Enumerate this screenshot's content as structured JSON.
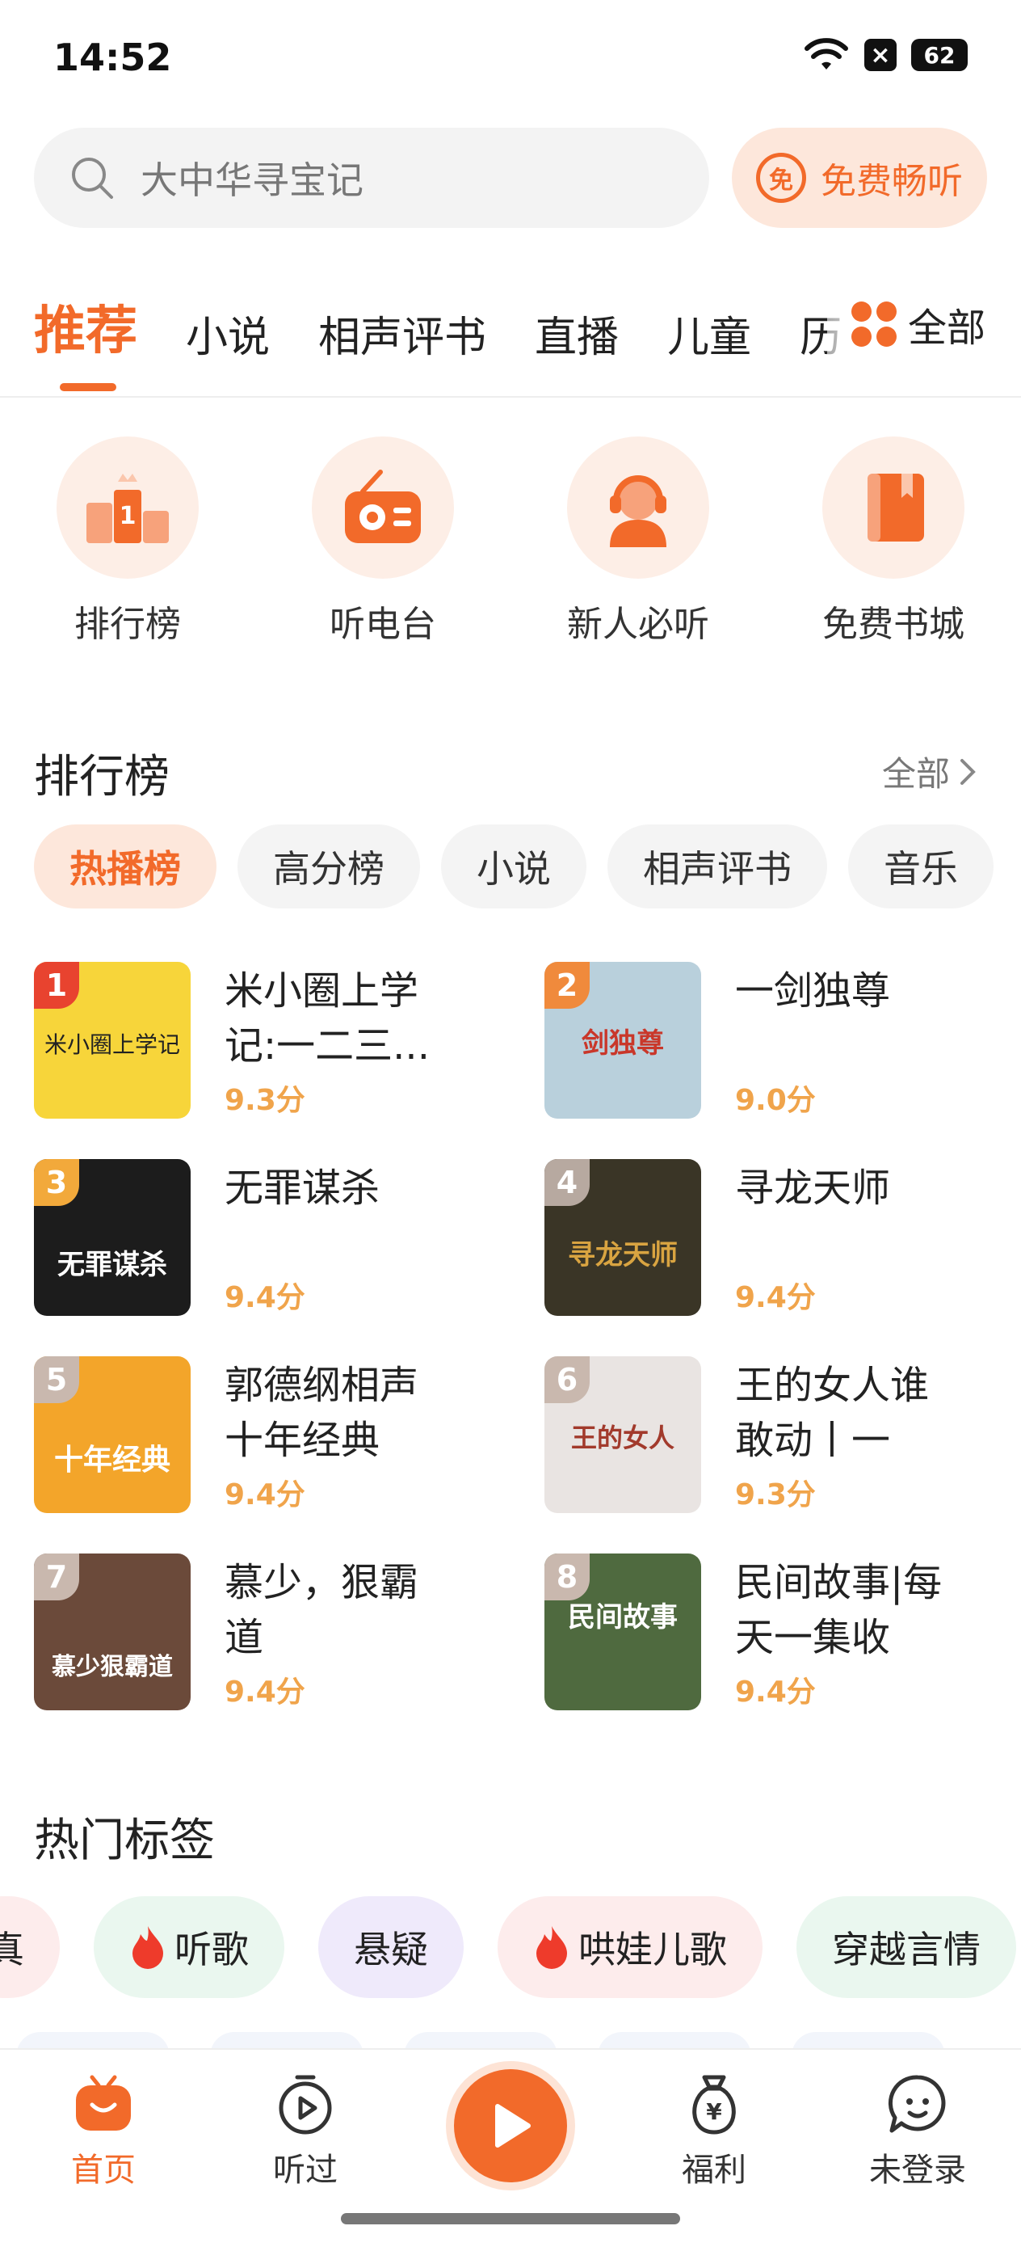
{
  "status_bar": {
    "time": "14:52",
    "battery": "62"
  },
  "search": {
    "placeholder": "大中华寻宝记",
    "free_label": "免费畅听",
    "free_icon_char": "免"
  },
  "tabs": [
    {
      "label": "推荐",
      "active": true
    },
    {
      "label": "小说"
    },
    {
      "label": "相声评书"
    },
    {
      "label": "直播"
    },
    {
      "label": "儿童"
    },
    {
      "label": "历"
    }
  ],
  "tabs_all_label": "全部",
  "quick_entries": [
    {
      "label": "排行榜",
      "icon": "podium-icon"
    },
    {
      "label": "听电台",
      "icon": "radio-icon"
    },
    {
      "label": "新人必听",
      "icon": "headset-person-icon"
    },
    {
      "label": "免费书城",
      "icon": "book-icon"
    }
  ],
  "ranking": {
    "title": "排行榜",
    "all_label": "全部",
    "chips": [
      "热播榜",
      "高分榜",
      "小说",
      "相声评书",
      "音乐"
    ],
    "items": [
      {
        "rank": "1",
        "name": "米小圈上学记:一二三...",
        "score": "9.3分",
        "cover_text": "米小圈上学记",
        "cover_color": "#f7d53a",
        "badge_color": "#e8432f"
      },
      {
        "rank": "2",
        "name": "一剑独尊",
        "score": "9.0分",
        "cover_text": "剑独尊",
        "cover_color": "#b9d0dc",
        "badge_color": "#f08a3c"
      },
      {
        "rank": "3",
        "name": "无罪谋杀",
        "score": "9.4分",
        "cover_text": "无罪谋杀",
        "cover_color": "#1c1c1c",
        "badge_color": "#f2a93b"
      },
      {
        "rank": "4",
        "name": "寻龙天师",
        "score": "9.4分",
        "cover_text": "寻龙天师",
        "cover_color": "#3a3526",
        "badge_color": "#b7a9a0"
      },
      {
        "rank": "5",
        "name": "郭德纲相声十年经典",
        "score": "9.4分",
        "cover_text": "十年经典",
        "cover_color": "#f3a52a",
        "badge_color": "#c9b8ae"
      },
      {
        "rank": "6",
        "name": "王的女人谁敢动丨一刀...",
        "score": "9.3分",
        "cover_text": "王的女人",
        "cover_color": "#e9e4e2",
        "badge_color": "#c9b8ae"
      },
      {
        "rank": "7",
        "name": "慕少，狠霸道",
        "score": "9.4分",
        "cover_text": "慕少狠霸道",
        "cover_color": "#6b4a3a",
        "badge_color": "#c9b8ae"
      },
      {
        "rank": "8",
        "name": "民间故事|每天一集收录...",
        "score": "9.4分",
        "cover_text": "民间故事",
        "cover_color": "#4f6a3f",
        "badge_color": "#c9b8ae"
      }
    ]
  },
  "hot_tags": {
    "title": "热门标签",
    "tags": [
      {
        "label": "真",
        "bg": "#fdecec",
        "flame": false
      },
      {
        "label": "听歌",
        "bg": "#eaf7ef",
        "flame": true
      },
      {
        "label": "悬疑",
        "bg": "#efeafb",
        "flame": false
      },
      {
        "label": "哄娃儿歌",
        "bg": "#fdecec",
        "flame": true
      },
      {
        "label": "穿越言情",
        "bg": "#eaf7ef",
        "flame": false
      }
    ]
  },
  "bottom_nav": [
    {
      "label": "首页",
      "icon": "home-tv-icon",
      "active": true
    },
    {
      "label": "听过",
      "icon": "history-play-icon"
    },
    {
      "label": "",
      "icon": "play-icon"
    },
    {
      "label": "福利",
      "icon": "money-bag-icon"
    },
    {
      "label": "未登录",
      "icon": "chat-face-icon"
    }
  ],
  "colors": {
    "accent": "#f26a2a",
    "score": "#f0a44b"
  }
}
